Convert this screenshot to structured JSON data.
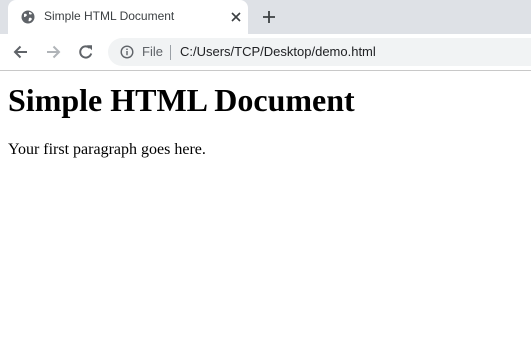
{
  "browser": {
    "tab": {
      "title": "Simple HTML Document",
      "icon": "globe-icon"
    },
    "toolbar": {
      "back_icon": "arrow-left-icon",
      "forward_icon": "arrow-right-icon",
      "reload_icon": "reload-icon",
      "omnibox": {
        "info_icon": "info-icon",
        "scheme_label": "File",
        "url": "C:/Users/TCP/Desktop/demo.html"
      }
    },
    "colors": {
      "tabstrip_bg": "#dee1e6",
      "omnibox_bg": "#f1f3f4",
      "icon_color": "#5f6368",
      "disabled_icon_color": "#b0b4b8"
    }
  },
  "page": {
    "heading": "Simple HTML Document",
    "paragraph": "Your first paragraph goes here."
  }
}
